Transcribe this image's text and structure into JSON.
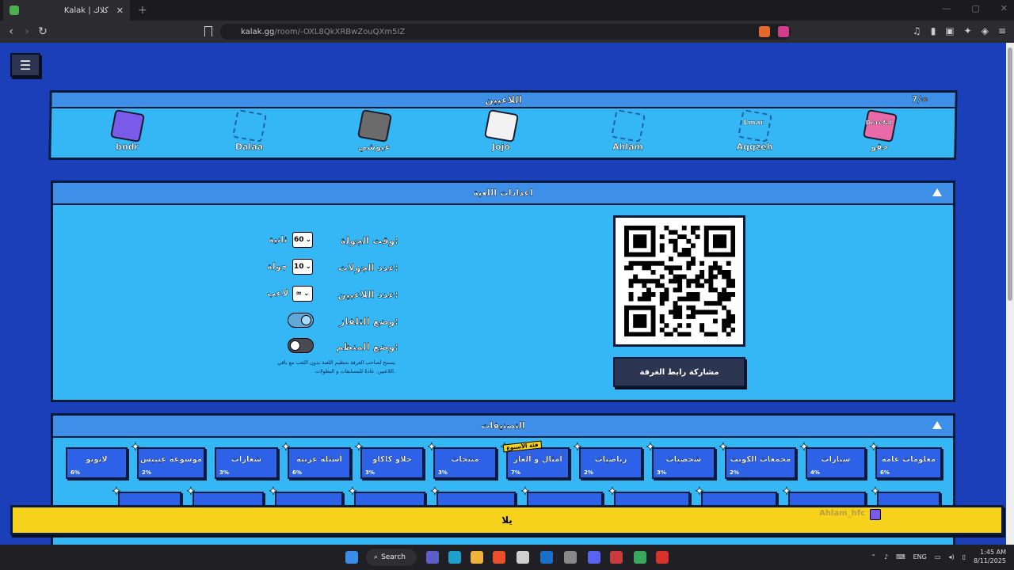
{
  "browser": {
    "tab_title": "Kalak | كلاك",
    "tab_close": "✕",
    "new_tab": "+",
    "url_host": "kalak.gg",
    "url_path": "/room/-OXL8QkXRBwZouQXm5IZ"
  },
  "players": {
    "title": "اللاعبين",
    "count": "7/∞",
    "list": [
      {
        "name": "bndr",
        "color": "#7a5ae8",
        "empty": false
      },
      {
        "name": "Dalaa",
        "color": "",
        "empty": true
      },
      {
        "name": "عبوشي",
        "color": "#6b6b6b",
        "empty": false
      },
      {
        "name": "Jojo",
        "color": "#f2f2f2",
        "empty": false
      },
      {
        "name": "Ahlam",
        "color": "",
        "empty": true
      },
      {
        "name": "Aqqzeh",
        "color": "",
        "empty": true,
        "tag": "Lmar"
      },
      {
        "name": "حقو",
        "color": "#e86aa8",
        "empty": false,
        "tag": "Dr.refal"
      }
    ]
  },
  "settings": {
    "title": "اعدادات اللعبة",
    "round_time_label": "وقت الجولة:",
    "round_time_value": "60",
    "round_time_unit": "ثانية",
    "rounds_label": "عدد الجولات:",
    "rounds_value": "10",
    "rounds_unit": "جولة",
    "players_label": "عدد اللاعبين:",
    "players_value": "∞",
    "players_unit": "لاعب",
    "tv_mode_label": "وضع التلفاز:",
    "tv_mode_on": true,
    "host_mode_label": "وضع المنظم:",
    "host_mode_on": false,
    "host_help_1": "يسمح لصاحب الغرفة بتنظيم اللعبة بدون اللعب مع باقي",
    "host_help_2": "اللاعبين. عادةً للمسابقات و البطولات.",
    "share_label": "مشاركة رابط الغرفة"
  },
  "categories": {
    "title": "التصنيفات",
    "weekly_badge": "فئة الأسبوع",
    "items": [
      {
        "name": "معلومات عامة",
        "pct": "6%"
      },
      {
        "name": "سيارات",
        "pct": "4%"
      },
      {
        "name": "مجمعات الكويت",
        "pct": "2%"
      },
      {
        "name": "شخصيات",
        "pct": "3%"
      },
      {
        "name": "رياضيات",
        "pct": "2%"
      },
      {
        "name": "أمثال و ألغاز",
        "pct": "7%"
      },
      {
        "name": "منتجات",
        "pct": "3%"
      },
      {
        "name": "حلاو كاكاو",
        "pct": "3%"
      },
      {
        "name": "أسئلة غريبة",
        "pct": "6%"
      },
      {
        "name": "شعارات",
        "pct": "3%"
      },
      {
        "name": "موسوعة غينيس",
        "pct": "2%"
      },
      {
        "name": "لابوبو",
        "pct": "6%"
      }
    ]
  },
  "start": {
    "label": "يلا",
    "user": "Ahlam_hfc"
  },
  "taskbar": {
    "search": "Search",
    "lang": "ENG",
    "time": "1:45 AM",
    "date": "8/11/2025"
  }
}
